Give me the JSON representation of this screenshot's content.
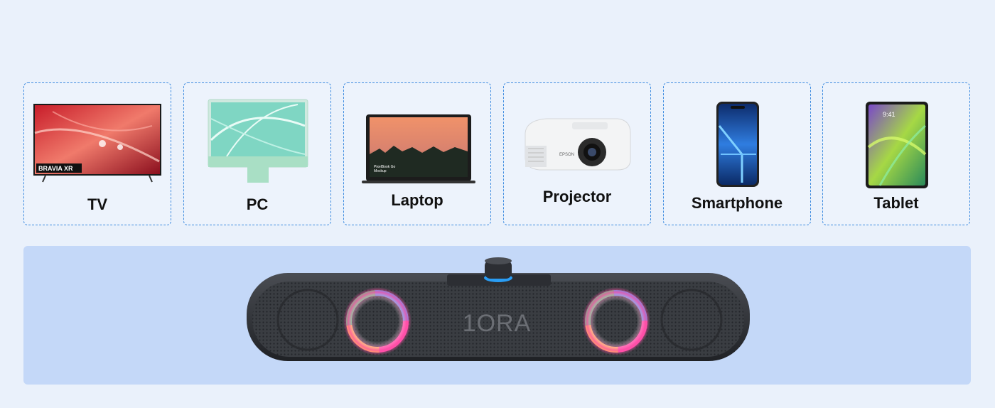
{
  "devices": [
    {
      "label": "TV",
      "icon": "tv-icon",
      "screen_text": "BRAVIA XR"
    },
    {
      "label": "PC",
      "icon": "pc-icon"
    },
    {
      "label": "Laptop",
      "icon": "laptop-icon",
      "screen_text_1": "PixelBook Go",
      "screen_text_2": "Mockup"
    },
    {
      "label": "Projector",
      "icon": "projector-icon",
      "brand_text": "EPSON"
    },
    {
      "label": "Smartphone",
      "icon": "smartphone-icon"
    },
    {
      "label": "Tablet",
      "icon": "tablet-icon",
      "screen_text": "9:41"
    }
  ],
  "speaker": {
    "brand": "1ORA"
  },
  "colors": {
    "card_border": "#3d8be0",
    "page_bg": "#eaf1fb",
    "panel_bg": "#c4d8f8"
  }
}
